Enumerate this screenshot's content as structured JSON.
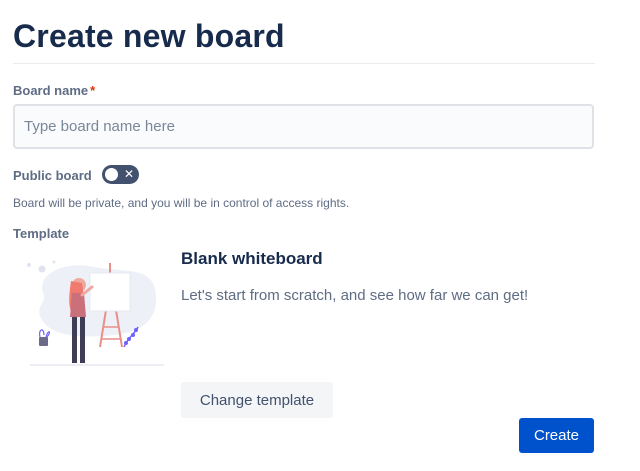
{
  "dialog": {
    "title": "Create new board"
  },
  "board_name": {
    "label": "Board name",
    "required_marker": "*",
    "value": "",
    "placeholder": "Type board name here"
  },
  "public_board": {
    "label": "Public board",
    "enabled": false,
    "toggle_icon": "close-icon",
    "helper_text": "Board will be private, and you will be in control of access rights."
  },
  "template": {
    "label": "Template",
    "name": "Blank whiteboard",
    "description": "Let's start from scratch, and see how far we can get!",
    "illustration_icon": "whiteboard-illustration-icon",
    "change_label": "Change template"
  },
  "actions": {
    "create_label": "Create"
  },
  "colors": {
    "heading": "#172b4d",
    "label": "#5e6c84",
    "required": "#de350b",
    "primary": "#0052cc",
    "toggle_off": "#42526e",
    "input_background": "#fafbfc",
    "input_border": "#dfe1e6",
    "secondary_button": "#f4f5f7"
  }
}
